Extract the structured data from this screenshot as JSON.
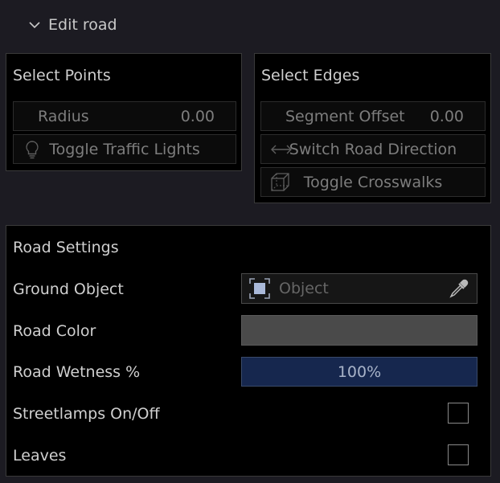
{
  "header": {
    "title": "Edit road",
    "icon": "chevron-down-icon"
  },
  "select_points": {
    "title": "Select Points",
    "radius": {
      "label": "Radius",
      "value": "0.00"
    },
    "toggle_traffic_lights": {
      "label": "Toggle Traffic Lights",
      "icon": "lightbulb-icon"
    }
  },
  "select_edges": {
    "title": "Select Edges",
    "segment_offset": {
      "label": "Segment Offset",
      "value": "0.00"
    },
    "switch_road_direction": {
      "label": "Switch Road Direction",
      "icon": "double-arrow-icon"
    },
    "toggle_crosswalks": {
      "label": "Toggle Crosswalks",
      "icon": "cube-icon"
    }
  },
  "road_settings": {
    "title": "Road Settings",
    "ground_object": {
      "label": "Ground Object",
      "placeholder": "Object",
      "icon": "object-picker-icon",
      "action_icon": "eyedropper-icon"
    },
    "road_color": {
      "label": "Road Color",
      "color": "#4a4a4a"
    },
    "road_wetness": {
      "label": "Road Wetness %",
      "value": "100%",
      "fraction": 1.0
    },
    "streetlamps": {
      "label": "Streetlamps On/Off",
      "checked": false
    },
    "leaves": {
      "label": "Leaves",
      "checked": false
    }
  },
  "colors": {
    "background": "#1c1b22",
    "panel": "#000000",
    "accent_blue": "#16274e"
  }
}
